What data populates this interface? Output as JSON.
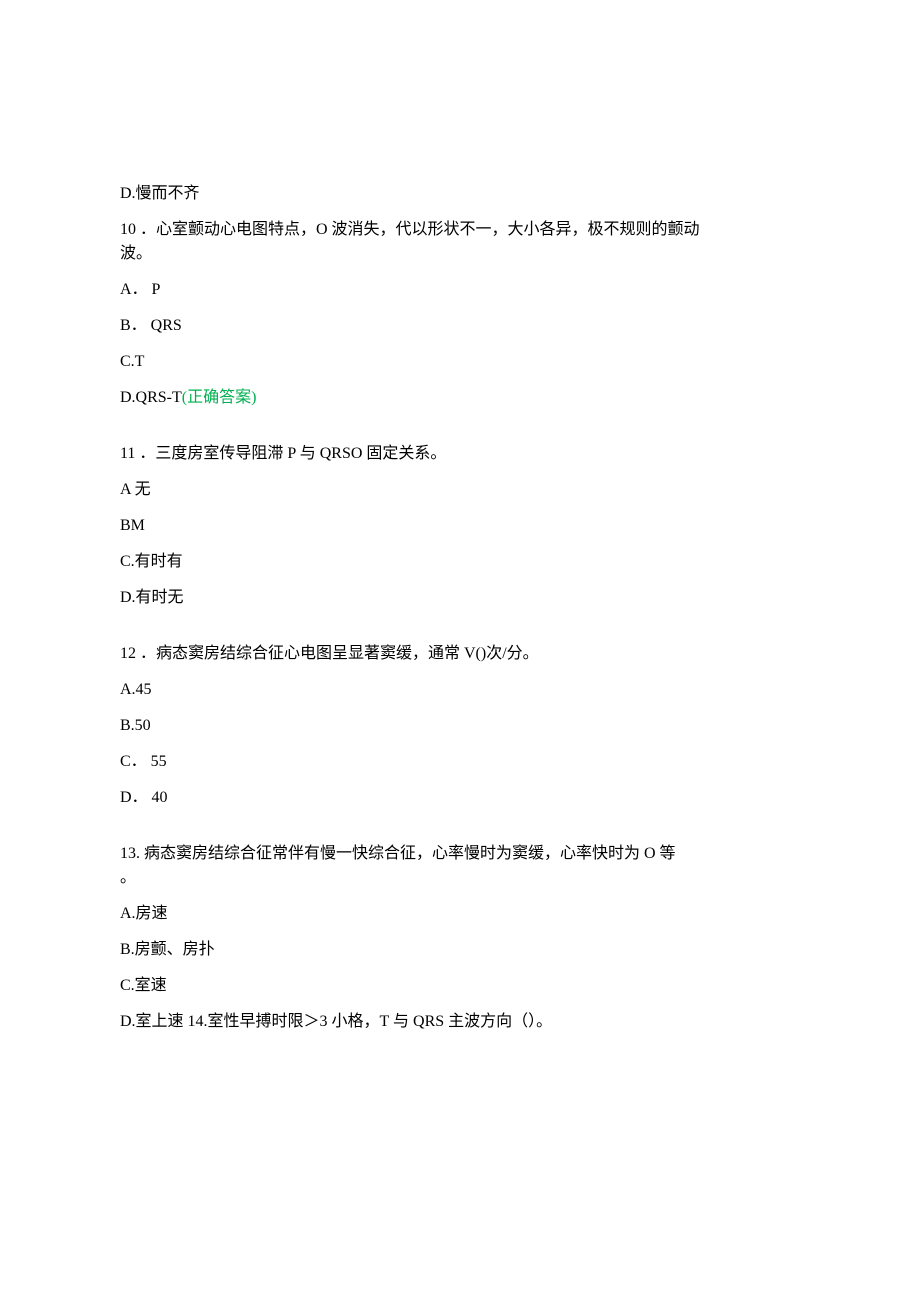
{
  "orphan_option_d": "D.慢而不齐",
  "q10": {
    "stem_line1": "10 ．心室颤动心电图特点，O 波消失，代以形状不一，大小各异，极不规则的颤动",
    "stem_line2": "波。",
    "a": "A． P",
    "b": "B． QRS",
    "c": "C.T",
    "d_prefix": "D.QRS-T",
    "d_answer": "(正确答案)"
  },
  "q11": {
    "stem": "11 ．三度房室传导阻滞 P 与 QRSO 固定关系。",
    "a": "A 无",
    "b": "BM",
    "c": "C.有时有",
    "d": "D.有时无"
  },
  "q12": {
    "stem": "12 ．病态窦房结综合征心电图呈显著窦缓，通常 V()次/分。",
    "a": "A.45",
    "b": "B.50",
    "c": "C． 55",
    "d": "D． 40"
  },
  "q13": {
    "stem_line1": "13. 病态窦房结综合征常伴有慢一快综合征，心率慢时为窦缓，心率快时为 O 等",
    "stem_line2": "。",
    "a": "A.房速",
    "b": "B.房颤、房扑",
    "c": "C.室速",
    "d": "D.室上速 14.室性早搏时限＞3 小格，T 与 QRS 主波方向（）。"
  }
}
